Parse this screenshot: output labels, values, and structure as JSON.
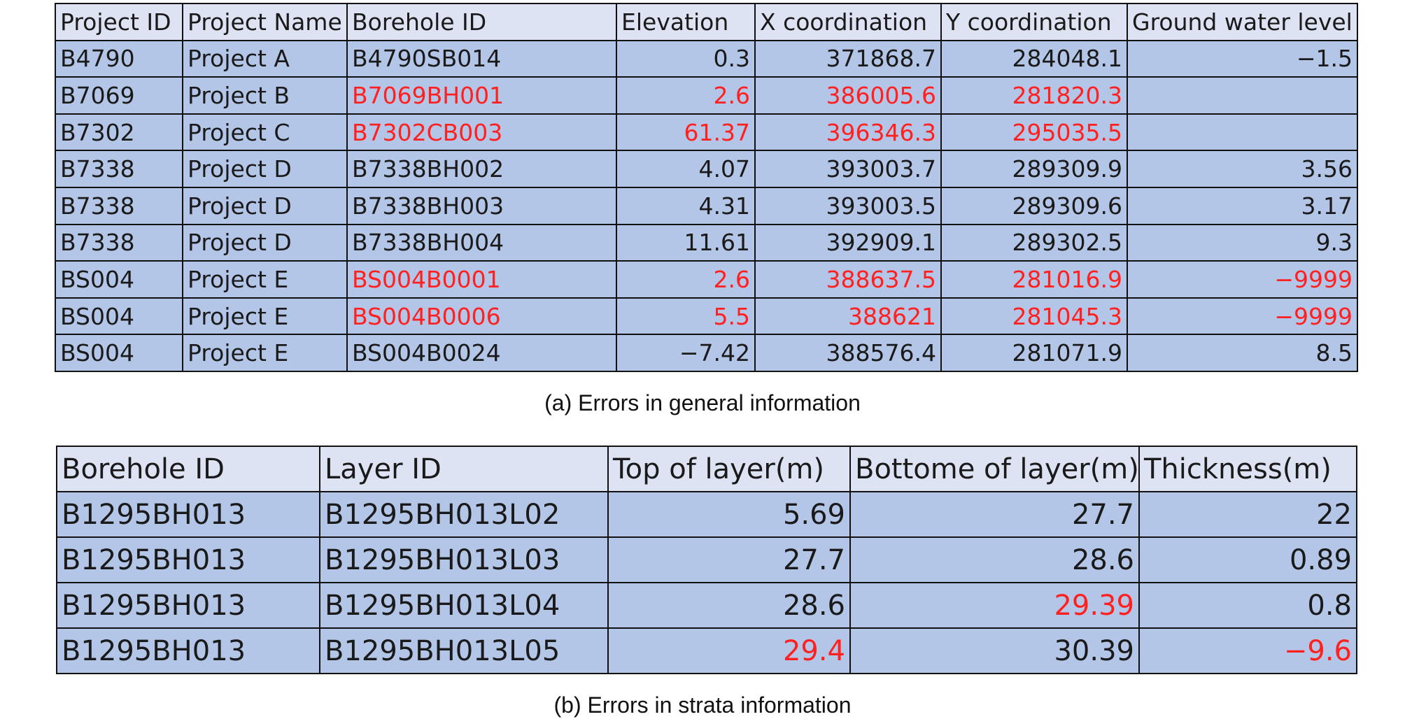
{
  "table_a": {
    "headers": [
      "Project ID",
      "Project Name",
      "Borehole ID",
      "Elevation",
      "X coordination",
      "Y coordination",
      "Ground water level"
    ],
    "rows": [
      {
        "cells": [
          "B4790",
          "Project A",
          "B4790SB014",
          "0.3",
          "371868.7",
          "284048.1",
          "−1.5"
        ],
        "error_cols": []
      },
      {
        "cells": [
          "B7069",
          "Project B",
          "B7069BH001",
          "2.6",
          "386005.6",
          "281820.3",
          ""
        ],
        "error_cols": [
          2,
          3,
          4,
          5
        ]
      },
      {
        "cells": [
          "B7302",
          "Project C",
          "B7302CB003",
          "61.37",
          "396346.3",
          "295035.5",
          ""
        ],
        "error_cols": [
          2,
          3,
          4,
          5
        ]
      },
      {
        "cells": [
          "B7338",
          "Project D",
          "B7338BH002",
          "4.07",
          "393003.7",
          "289309.9",
          "3.56"
        ],
        "error_cols": []
      },
      {
        "cells": [
          "B7338",
          "Project D",
          "B7338BH003",
          "4.31",
          "393003.5",
          "289309.6",
          "3.17"
        ],
        "error_cols": []
      },
      {
        "cells": [
          "B7338",
          "Project D",
          "B7338BH004",
          "11.61",
          "392909.1",
          "289302.5",
          "9.3"
        ],
        "error_cols": []
      },
      {
        "cells": [
          "BS004",
          "Project E",
          "BS004B0001",
          "2.6",
          "388637.5",
          "281016.9",
          "−9999"
        ],
        "error_cols": [
          2,
          3,
          4,
          5,
          6
        ]
      },
      {
        "cells": [
          "BS004",
          "Project E",
          "BS004B0006",
          "5.5",
          "388621",
          "281045.3",
          "−9999"
        ],
        "error_cols": [
          2,
          3,
          4,
          5,
          6
        ]
      },
      {
        "cells": [
          "BS004",
          "Project E",
          "BS004B0024",
          "−7.42",
          "388576.4",
          "281071.9",
          "8.5"
        ],
        "error_cols": []
      }
    ],
    "numeric_cols": [
      3,
      4,
      5,
      6
    ],
    "caption": "(a)  Errors  in  general  information"
  },
  "table_b": {
    "headers": [
      "Borehole ID",
      "Layer ID",
      "Top of layer(m)",
      "Bottome of layer(m)",
      "Thickness(m)"
    ],
    "rows": [
      {
        "cells": [
          "B1295BH013",
          "B1295BH013L02",
          "5.69",
          "27.7",
          "22"
        ],
        "error_cols": []
      },
      {
        "cells": [
          "B1295BH013",
          "B1295BH013L03",
          "27.7",
          "28.6",
          "0.89"
        ],
        "error_cols": []
      },
      {
        "cells": [
          "B1295BH013",
          "B1295BH013L04",
          "28.6",
          "29.39",
          "0.8"
        ],
        "error_cols": [
          3
        ]
      },
      {
        "cells": [
          "B1295BH013",
          "B1295BH013L05",
          "29.4",
          "30.39",
          "−9.6"
        ],
        "error_cols": [
          2,
          4
        ]
      }
    ],
    "numeric_cols": [
      2,
      3,
      4
    ],
    "caption": "(b)  Errors  in  strata  information"
  },
  "colors": {
    "header_bg": "#dde3f3",
    "cell_bg": "#b4c6e7",
    "error_text": "#ff2020",
    "border": "#111111"
  }
}
